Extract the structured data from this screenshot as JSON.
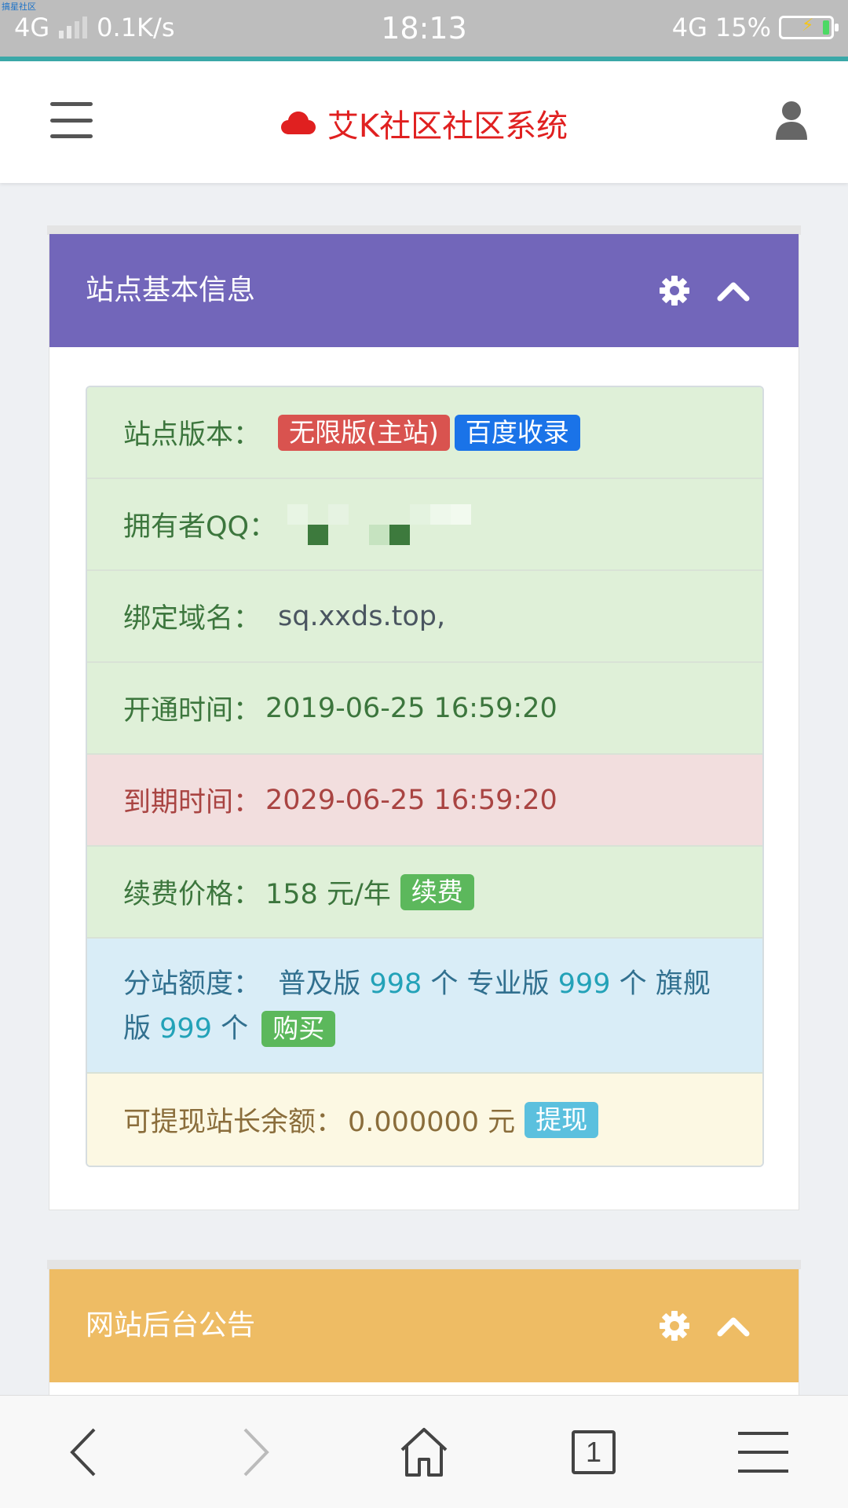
{
  "status_bar": {
    "tiny_label": "搞星社区",
    "network": "4G",
    "speed": "0.1K/s",
    "time": "18:13",
    "network_right": "4G",
    "battery": "15%"
  },
  "header": {
    "brand_icon": "cloud-icon",
    "title": "艾K社区社区系统",
    "menu_icon": "hamburger-menu-icon",
    "user_icon": "user-icon"
  },
  "panel_info": {
    "title": "站点基本信息",
    "header_color": "#7266ba",
    "rows": {
      "version": {
        "label": "站点版本：",
        "badge1": "无限版(主站)",
        "badge2": "百度收录"
      },
      "owner_qq": {
        "label": "拥有者QQ："
      },
      "domain": {
        "label": "绑定域名：",
        "value": "sq.xxds.top,"
      },
      "open_time": {
        "label": "开通时间：",
        "value": "2019-06-25 16:59:20"
      },
      "expire_time": {
        "label": "到期时间：",
        "value": "2029-06-25 16:59:20"
      },
      "renew": {
        "label": "续费价格：",
        "value": "158 元/年",
        "button": "续费"
      },
      "quota": {
        "label": "分站额度：",
        "basic": "普及版",
        "basic_count": "998",
        "pro": "专业版",
        "pro_count": "999",
        "flagship": "旗舰版",
        "flagship_count": "999",
        "unit": "个",
        "button": "购买"
      },
      "balance": {
        "label": "可提现站长余额：",
        "value": "0.000000 元",
        "button": "提现"
      }
    }
  },
  "panel_notice": {
    "title": "网站后台公告",
    "header_color": "#eebc64"
  },
  "browser_bar": {
    "tab_count": "1"
  }
}
